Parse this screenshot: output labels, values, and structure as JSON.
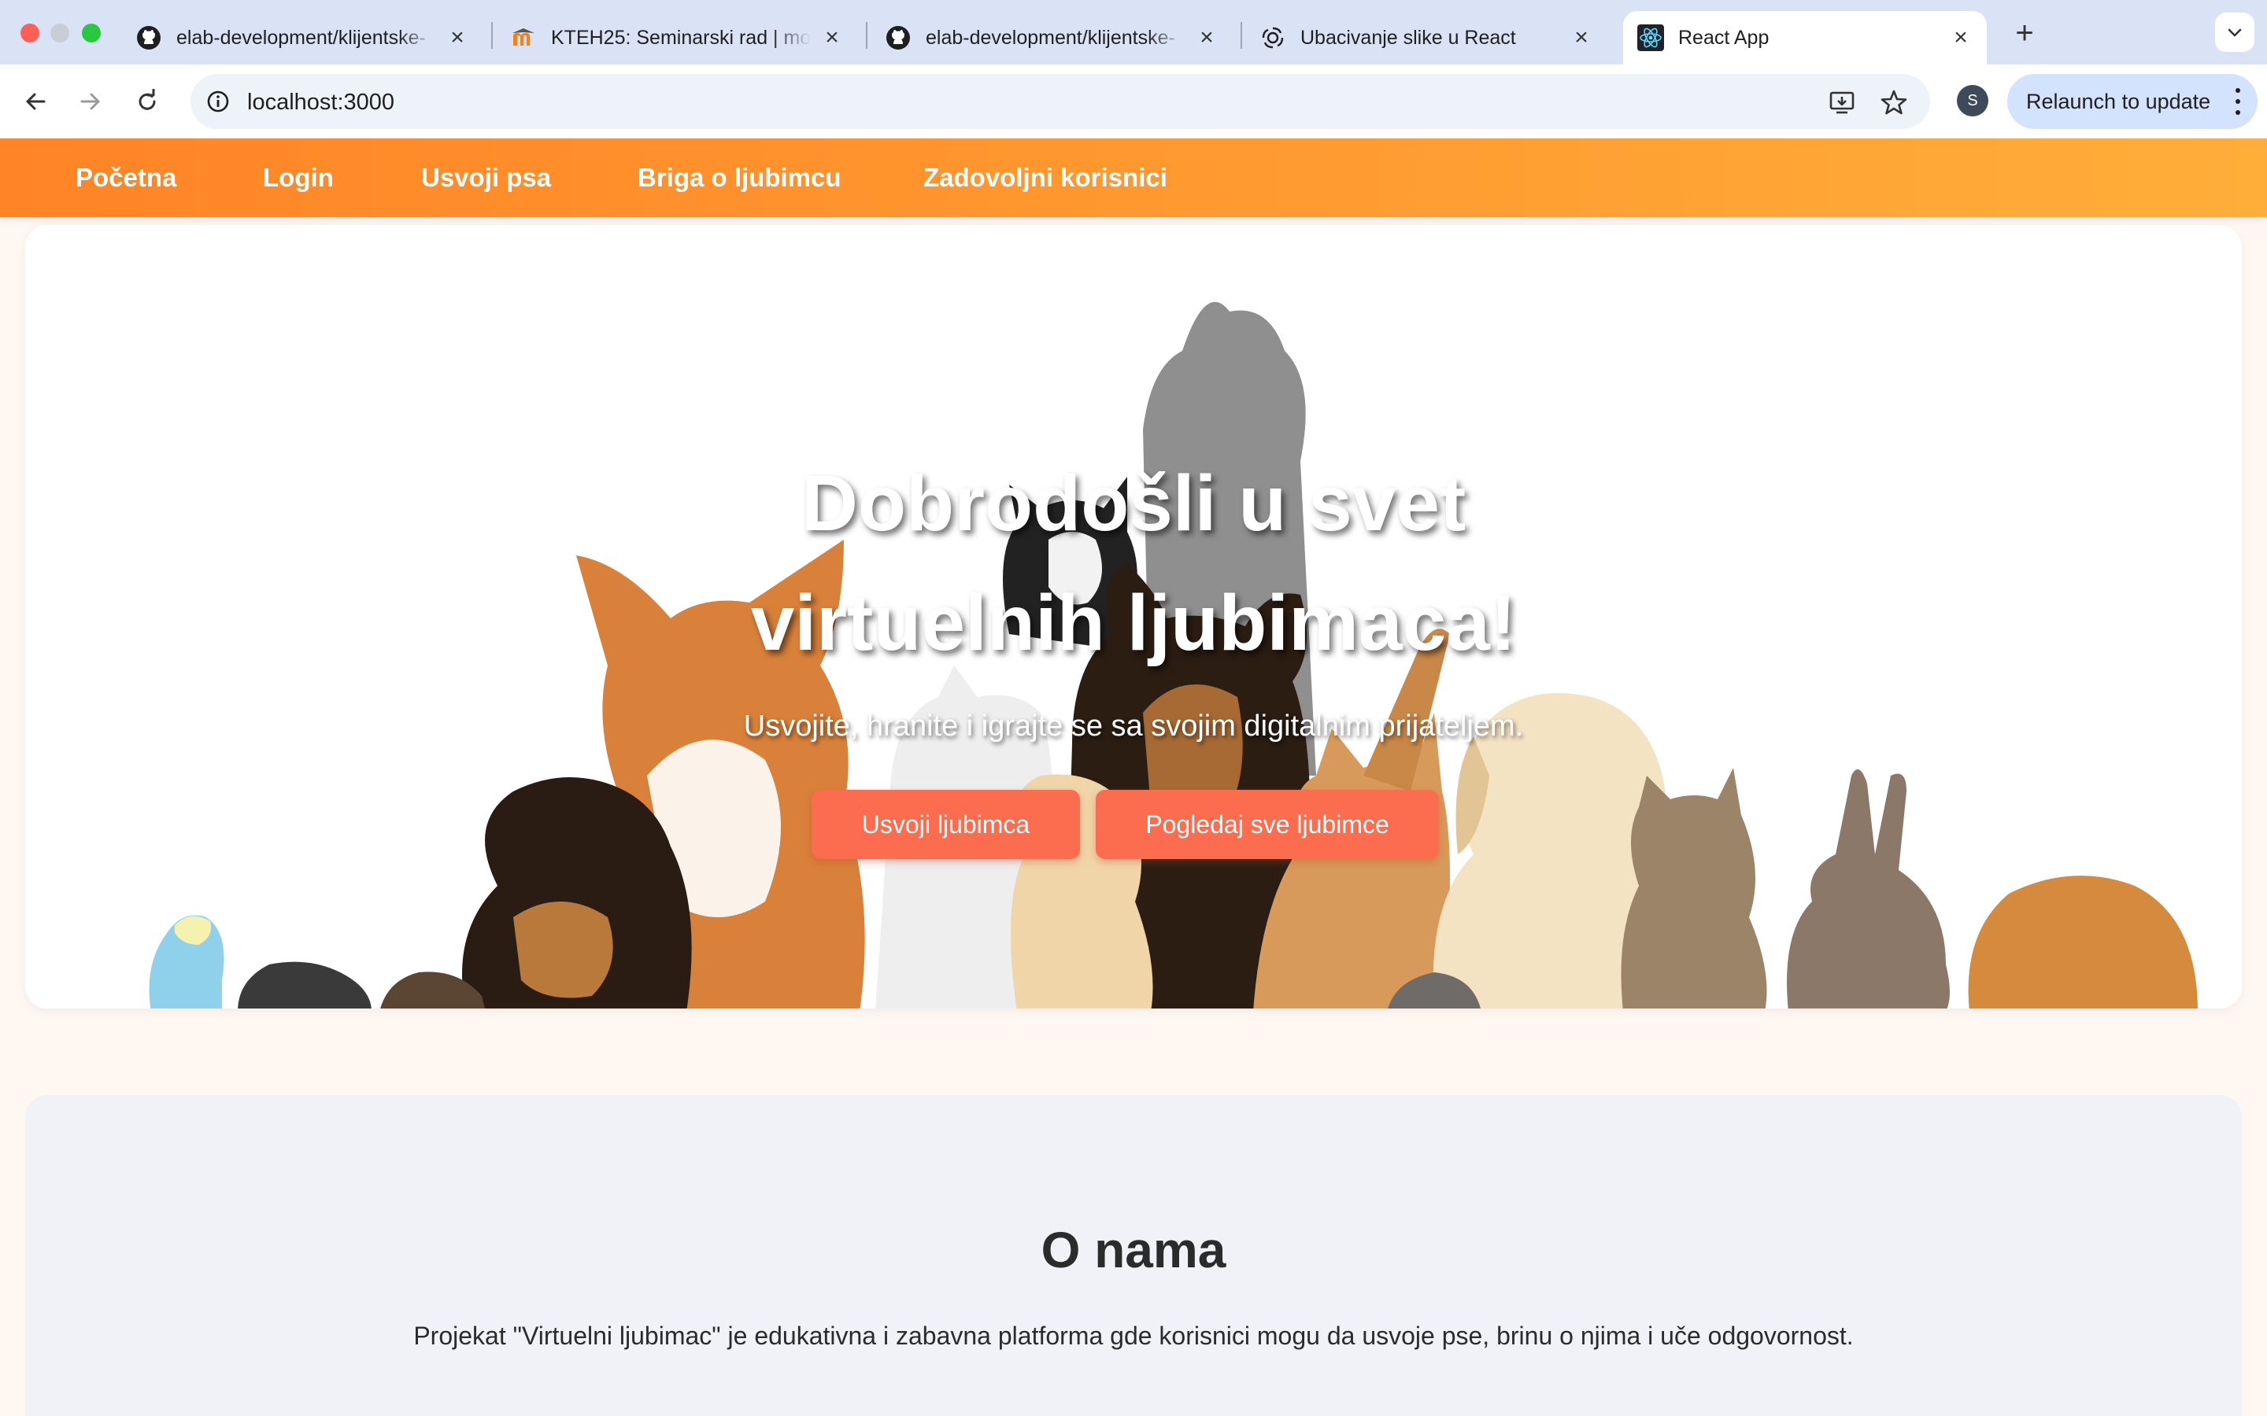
{
  "browser": {
    "tabs": [
      {
        "title": "elab-development/klijentske-",
        "favicon": "github-icon"
      },
      {
        "title": "KTEH25: Seminarski rad | moodle",
        "favicon": "moodle-icon"
      },
      {
        "title": "elab-development/klijentske-",
        "favicon": "github-icon"
      },
      {
        "title": "Ubacivanje slike u React",
        "favicon": "openai-icon"
      },
      {
        "title": "React App",
        "favicon": "react-icon",
        "active": true
      }
    ],
    "address": "localhost:3000",
    "profile_initial": "S",
    "relaunch_label": "Relaunch to update"
  },
  "navbar": {
    "items": [
      "Početna",
      "Login",
      "Usvoji psa",
      "Briga o ljubimcu",
      "Zadovoljni korisnici"
    ]
  },
  "hero": {
    "title": "Dobrodošli u svet virtuelnih ljubimaca!",
    "subtitle": "Usvojite, hranite i igrajte se sa svojim digitalnim prijateljem.",
    "primary_button": "Usvoji ljubimca",
    "secondary_button": "Pogledaj sve ljubimce"
  },
  "about": {
    "heading": "O nama",
    "text": "Projekat \"Virtuelni ljubimac\" je edukativna i zabavna platforma gde korisnici mogu da usvoje pse, brinu o njima i uče odgovornost."
  },
  "colors": {
    "nav_gradient_start": "#ff8426",
    "nav_gradient_end": "#ffae3a",
    "button": "#fc6c4e",
    "page_bg": "#fff7f2",
    "about_bg": "#f0f2f7"
  }
}
